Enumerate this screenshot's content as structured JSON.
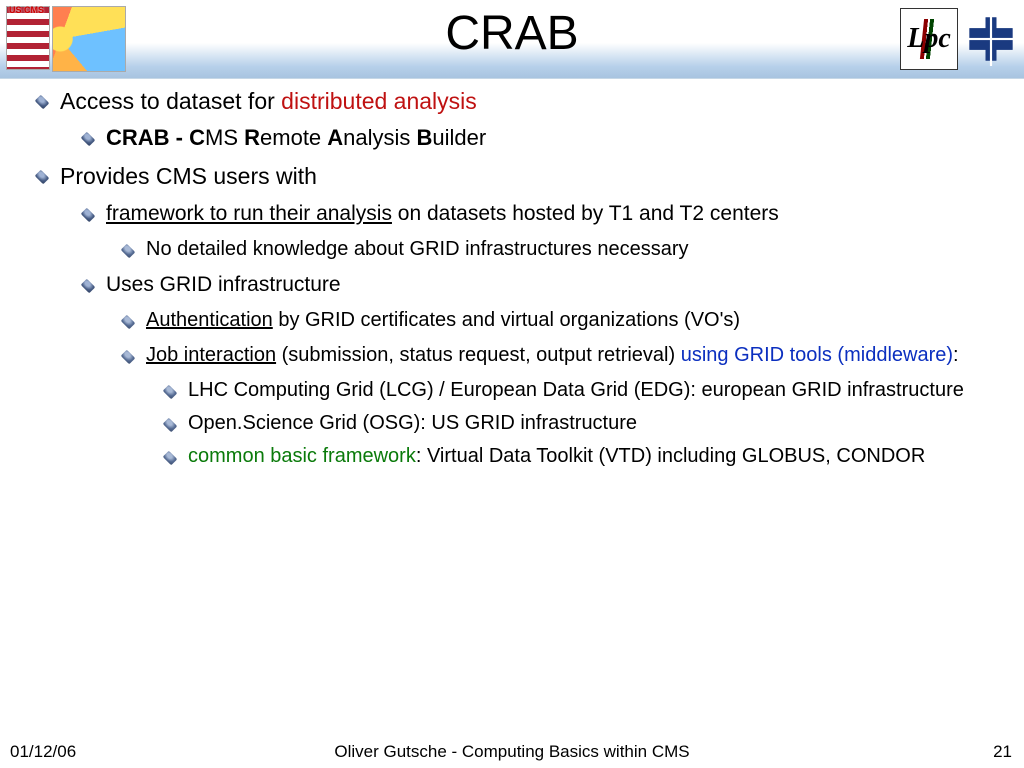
{
  "title": "CRAB",
  "logos": {
    "left_label": "US CMS",
    "lpc": "Lpc"
  },
  "bullets": {
    "l1a_pre": "Access to dataset for ",
    "l1a_red": "distributed analysis",
    "l2a_pre": "CRAB - ",
    "l2a_c": "C",
    "l2a_ms": "MS ",
    "l2a_r": "R",
    "l2a_emote": "emote ",
    "l2a_a": "A",
    "l2a_nalysis": "nalysis ",
    "l2a_b": "B",
    "l2a_uilder": "uilder",
    "l1b": "Provides CMS users with",
    "l3a_u": "framework to run their analysis",
    "l3a_rest": " on datasets hosted by T1 and T2 centers",
    "l4a": "No detailed knowledge about GRID infrastructures necessary",
    "l3b": "Uses GRID infrastructure",
    "l4b_u": "Authentication",
    "l4b_rest": " by GRID certificates and virtual organizations (VO's)",
    "l4c_u": "Job interaction",
    "l4c_mid": " (submission, status request, output retrieval) ",
    "l4c_blue": "using GRID tools (middleware)",
    "l4c_colon": ":",
    "l5a": "LHC Computing Grid (LCG) / European Data Grid (EDG): european GRID infrastructure",
    "l5b": "Open.Science Grid (OSG): US GRID infrastructure",
    "l5c_green": "common basic framework",
    "l5c_rest": ": Virtual Data Toolkit (VTD) including GLOBUS, CONDOR"
  },
  "footer": {
    "date": "01/12/06",
    "center": "Oliver Gutsche - Computing Basics within CMS",
    "page": "21"
  }
}
